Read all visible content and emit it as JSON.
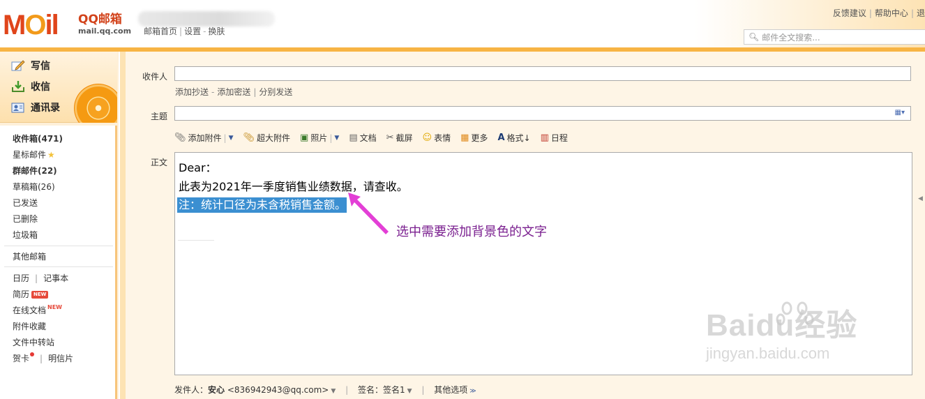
{
  "brand": {
    "logo_text": "MOil",
    "name": "QQ邮箱",
    "domain": "mail.qq.com"
  },
  "top_links": {
    "home": "邮箱首页",
    "settings": "设置",
    "skin": "换肤"
  },
  "right_links": {
    "feedback": "反馈建议",
    "help": "帮助中心",
    "exit": "退"
  },
  "search": {
    "placeholder": "邮件全文搜索..."
  },
  "quick_actions": {
    "compose": "写信",
    "inbox": "收信",
    "contacts": "通讯录"
  },
  "folders": {
    "inbox": "收件箱(471)",
    "starred": "星标邮件",
    "group": "群邮件(22)",
    "drafts": "草稿箱(26)",
    "sent": "已发送",
    "deleted": "已删除",
    "trash": "垃圾箱",
    "other_mailbox": "其他邮箱",
    "calendar": "日历",
    "notes": "记事本",
    "resume": "简历",
    "resume_badge": "NEW",
    "docs": "在线文档",
    "docs_badge": "NEW",
    "attachments": "附件收藏",
    "transfer": "文件中转站",
    "greeting": "贺卡",
    "postcard": "明信片"
  },
  "compose": {
    "to_label": "收件人",
    "to_value": "",
    "cc_links": {
      "add_cc": "添加抄送",
      "add_bcc": "添加密送",
      "separate": "分别发送"
    },
    "subject_label": "主题",
    "subject_value": "",
    "body_label": "正文",
    "toolbar": {
      "attach": "添加附件",
      "large_attach": "超大附件",
      "photo": "照片",
      "doc": "文档",
      "screenshot": "截屏",
      "emoji": "表情",
      "more": "更多",
      "format": "格式↓",
      "schedule": "日程"
    },
    "body": {
      "line1": "Dear：",
      "line2": "此表为2021年一季度销售业绩数据，请查收。",
      "line3_selected": "注：统计口径为未含税销售金额。"
    }
  },
  "annotation": {
    "text": "选中需要添加背景色的文字",
    "color": "#7a1f8f",
    "arrow_color": "#e33fd6"
  },
  "footer": {
    "sender_label": "发件人：",
    "sender_name": "安心",
    "sender_email": "<836942943@qq.com>",
    "signature_label": "签名：",
    "signature_value": "签名1",
    "other_options": "其他选项"
  },
  "watermark": {
    "line1": "Baidu经验",
    "line2": "jingyan.baidu.com"
  },
  "colors": {
    "accent": "#f7b444",
    "brand_red": "#e0451b",
    "selection": "#3b8fd1"
  }
}
